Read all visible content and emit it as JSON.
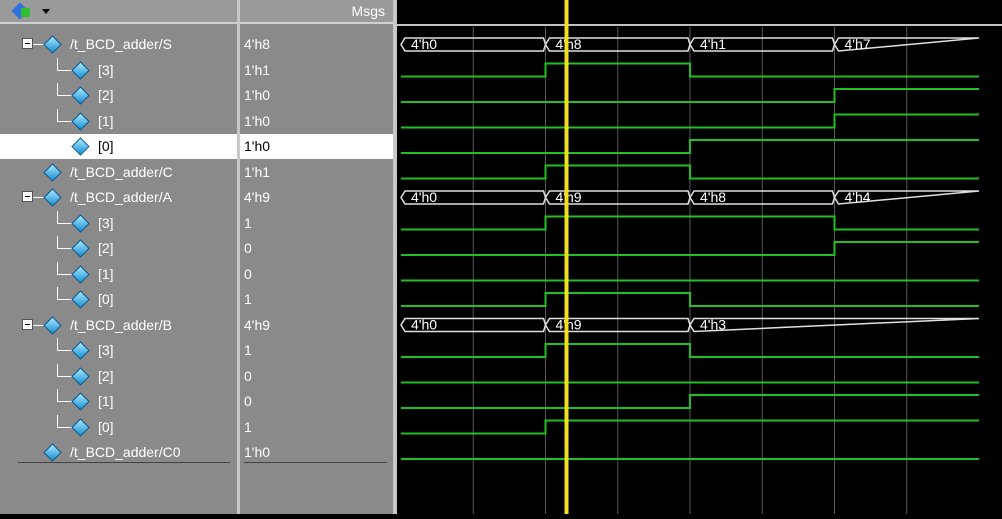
{
  "header": {
    "msgs_label": "Msgs",
    "toolbar_icon": "wave-signals-icon"
  },
  "signals": [
    {
      "name": "/t_BCD_adder/S",
      "value": "4'h8",
      "kind": "bus",
      "expanded": true,
      "level": 0
    },
    {
      "name": "[3]",
      "value": "1'h1",
      "kind": "bit",
      "level": 1
    },
    {
      "name": "[2]",
      "value": "1'h0",
      "kind": "bit",
      "level": 1
    },
    {
      "name": "[1]",
      "value": "1'h0",
      "kind": "bit",
      "level": 1
    },
    {
      "name": "[0]",
      "value": "1'h0",
      "kind": "bit",
      "level": 1,
      "selected": true
    },
    {
      "name": "/t_BCD_adder/C",
      "value": "1'h1",
      "kind": "bit",
      "level": 0
    },
    {
      "name": "/t_BCD_adder/A",
      "value": "4'h9",
      "kind": "bus",
      "expanded": true,
      "level": 0
    },
    {
      "name": "[3]",
      "value": "1",
      "kind": "bit",
      "level": 1
    },
    {
      "name": "[2]",
      "value": "0",
      "kind": "bit",
      "level": 1
    },
    {
      "name": "[1]",
      "value": "0",
      "kind": "bit",
      "level": 1
    },
    {
      "name": "[0]",
      "value": "1",
      "kind": "bit",
      "level": 1
    },
    {
      "name": "/t_BCD_adder/B",
      "value": "4'h9",
      "kind": "bus",
      "expanded": true,
      "level": 0
    },
    {
      "name": "[3]",
      "value": "1",
      "kind": "bit",
      "level": 1
    },
    {
      "name": "[2]",
      "value": "0",
      "kind": "bit",
      "level": 1
    },
    {
      "name": "[1]",
      "value": "0",
      "kind": "bit",
      "level": 1
    },
    {
      "name": "[0]",
      "value": "1",
      "kind": "bit",
      "level": 1
    },
    {
      "name": "/t_BCD_adder/C0",
      "value": "1'h0",
      "kind": "bit",
      "level": 0
    }
  ],
  "waveforms": {
    "segment_starts": [
      0,
      1,
      2,
      3
    ],
    "rows": [
      {
        "type": "bus",
        "labels": [
          "4'h0",
          "4'h8",
          "4'h1",
          "4'h7"
        ]
      },
      {
        "type": "bit",
        "levels": [
          0,
          1,
          0,
          0
        ]
      },
      {
        "type": "bit",
        "levels": [
          0,
          0,
          0,
          1
        ]
      },
      {
        "type": "bit",
        "levels": [
          0,
          0,
          0,
          1
        ]
      },
      {
        "type": "bit",
        "levels": [
          0,
          0,
          1,
          1
        ]
      },
      {
        "type": "bit",
        "levels": [
          0,
          1,
          0,
          0
        ]
      },
      {
        "type": "bus",
        "labels": [
          "4'h0",
          "4'h9",
          "4'h8",
          "4'h4"
        ]
      },
      {
        "type": "bit",
        "levels": [
          0,
          1,
          1,
          0
        ]
      },
      {
        "type": "bit",
        "levels": [
          0,
          0,
          0,
          1
        ]
      },
      {
        "type": "bit",
        "levels": [
          0,
          0,
          0,
          0
        ]
      },
      {
        "type": "bit",
        "levels": [
          0,
          1,
          0,
          0
        ]
      },
      {
        "type": "bus",
        "labels": [
          "4'h0",
          "4'h9",
          "4'h3",
          "4'h3"
        ]
      },
      {
        "type": "bit",
        "levels": [
          0,
          1,
          0,
          0
        ]
      },
      {
        "type": "bit",
        "levels": [
          0,
          0,
          0,
          0
        ]
      },
      {
        "type": "bit",
        "levels": [
          0,
          0,
          1,
          1
        ]
      },
      {
        "type": "bit",
        "levels": [
          0,
          1,
          1,
          1
        ]
      },
      {
        "type": "bit",
        "levels": [
          0,
          0,
          0,
          0
        ]
      }
    ]
  },
  "colors": {
    "wave": "#20c020",
    "bus": "#e0e0e0",
    "cursor": "#f0e020",
    "grid": "#5a5a5a"
  }
}
